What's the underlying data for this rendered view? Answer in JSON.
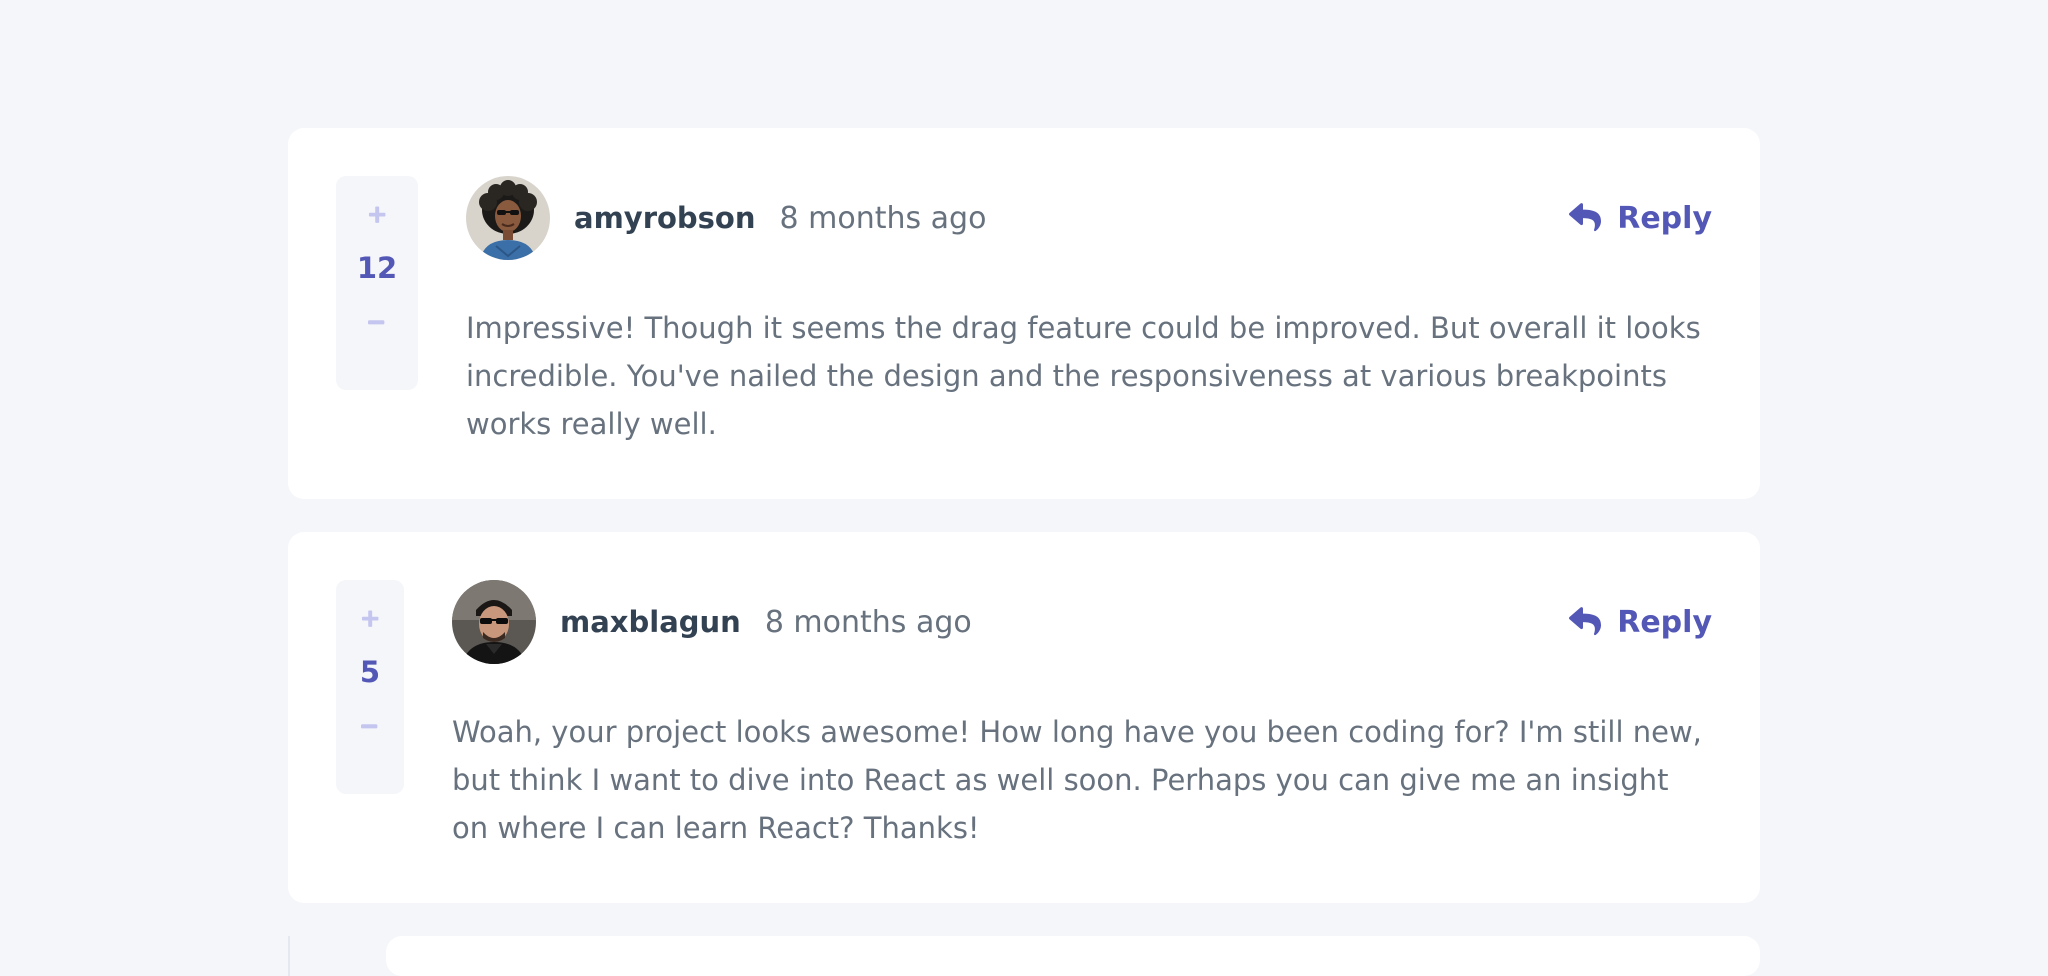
{
  "comments": [
    {
      "username": "amyrobson",
      "time": "8 months ago",
      "score": "12",
      "reply_label": "Reply",
      "text": "Impressive! Though it seems the drag feature could be improved. But overall it looks incredible. You've nailed the design and the responsiveness at various breakpoints works really well."
    },
    {
      "username": "maxblagun",
      "time": "8 months ago",
      "score": "5",
      "reply_label": "Reply",
      "text": "Woah, your project looks awesome! How long have you been coding for? I'm still new, but think I want to dive into React as well soon. Perhaps you can give me an insight on where I can learn React? Thanks!"
    }
  ],
  "icons": {
    "plus": "plus-icon",
    "minus": "minus-icon",
    "reply": "reply-arrow-icon"
  },
  "colors": {
    "background": "#f5f6fa",
    "card": "#ffffff",
    "accent": "#5357b6",
    "vote_icon": "#c5c6ef",
    "username": "#334253",
    "body_text": "#67727e"
  }
}
